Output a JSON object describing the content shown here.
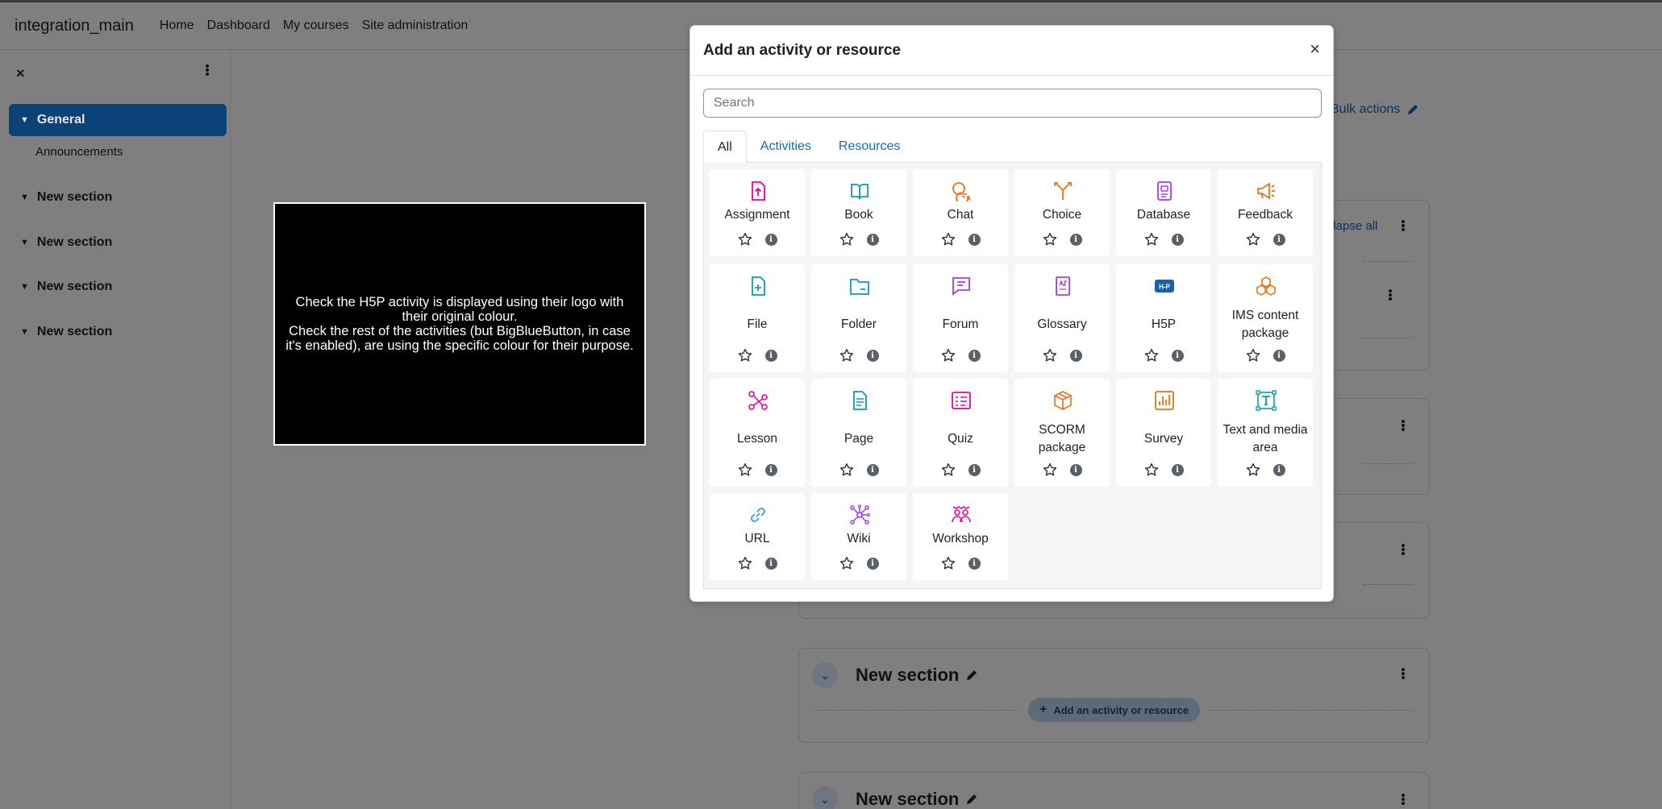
{
  "navbar": {
    "brand": "integration_main",
    "links": [
      "Home",
      "Dashboard",
      "My courses",
      "Site administration"
    ]
  },
  "drawer": {
    "close_glyph": "×",
    "sections": [
      {
        "label": "General",
        "active": true
      },
      {
        "label": "New section"
      },
      {
        "label": "New section"
      },
      {
        "label": "New section"
      },
      {
        "label": "New section"
      }
    ],
    "general_items": [
      "Announcements"
    ]
  },
  "course": {
    "bulk_actions": "Bulk actions",
    "collapse_all": "llapse all",
    "section_title": "New section",
    "add_activity": "Add an activity or resource"
  },
  "instructions": {
    "line1": "Check the H5P activity is displayed using their logo with their original colour.",
    "line2": "Check the rest of the activities (but BigBlueButton, in case it's enabled), are using the specific colour for their purpose."
  },
  "modal": {
    "title": "Add an activity or resource",
    "close_glyph": "×",
    "search_placeholder": "Search",
    "tabs": [
      "All",
      "Activities",
      "Resources"
    ],
    "active_tab": "All",
    "colors": {
      "assessment": "#eb00a2",
      "content": "#0a9eb0",
      "communication": "#ec7014",
      "administration": "#a23dee",
      "interactive": "#ec7014",
      "link": "#399be2",
      "h5p": "#1563af"
    },
    "items": [
      {
        "name": "Assignment",
        "icon": "assignment-icon",
        "purpose": "assessment"
      },
      {
        "name": "Book",
        "icon": "book-icon",
        "purpose": "content"
      },
      {
        "name": "Chat",
        "icon": "chat-icon",
        "purpose": "communication"
      },
      {
        "name": "Choice",
        "icon": "choice-icon",
        "purpose": "communication"
      },
      {
        "name": "Database",
        "icon": "database-icon",
        "purpose": "administration"
      },
      {
        "name": "Feedback",
        "icon": "feedback-icon",
        "purpose": "communication"
      },
      {
        "name": "File",
        "icon": "file-icon",
        "purpose": "content"
      },
      {
        "name": "Folder",
        "icon": "folder-icon",
        "purpose": "content"
      },
      {
        "name": "Forum",
        "icon": "forum-icon",
        "purpose": "administration"
      },
      {
        "name": "Glossary",
        "icon": "glossary-icon",
        "purpose": "administration"
      },
      {
        "name": "H5P",
        "icon": "h5p-icon",
        "purpose": "h5p"
      },
      {
        "name": "IMS content package",
        "icon": "ims-package-icon",
        "purpose": "interactive"
      },
      {
        "name": "Lesson",
        "icon": "lesson-icon",
        "purpose": "assessment"
      },
      {
        "name": "Page",
        "icon": "page-icon",
        "purpose": "content"
      },
      {
        "name": "Quiz",
        "icon": "quiz-icon",
        "purpose": "assessment"
      },
      {
        "name": "SCORM package",
        "icon": "scorm-icon",
        "purpose": "interactive"
      },
      {
        "name": "Survey",
        "icon": "survey-icon",
        "purpose": "interactive"
      },
      {
        "name": "Text and media area",
        "icon": "text-media-icon",
        "purpose": "content"
      },
      {
        "name": "URL",
        "icon": "url-icon",
        "purpose": "link"
      },
      {
        "name": "Wiki",
        "icon": "wiki-icon",
        "purpose": "administration"
      },
      {
        "name": "Workshop",
        "icon": "workshop-icon",
        "purpose": "assessment"
      }
    ]
  }
}
